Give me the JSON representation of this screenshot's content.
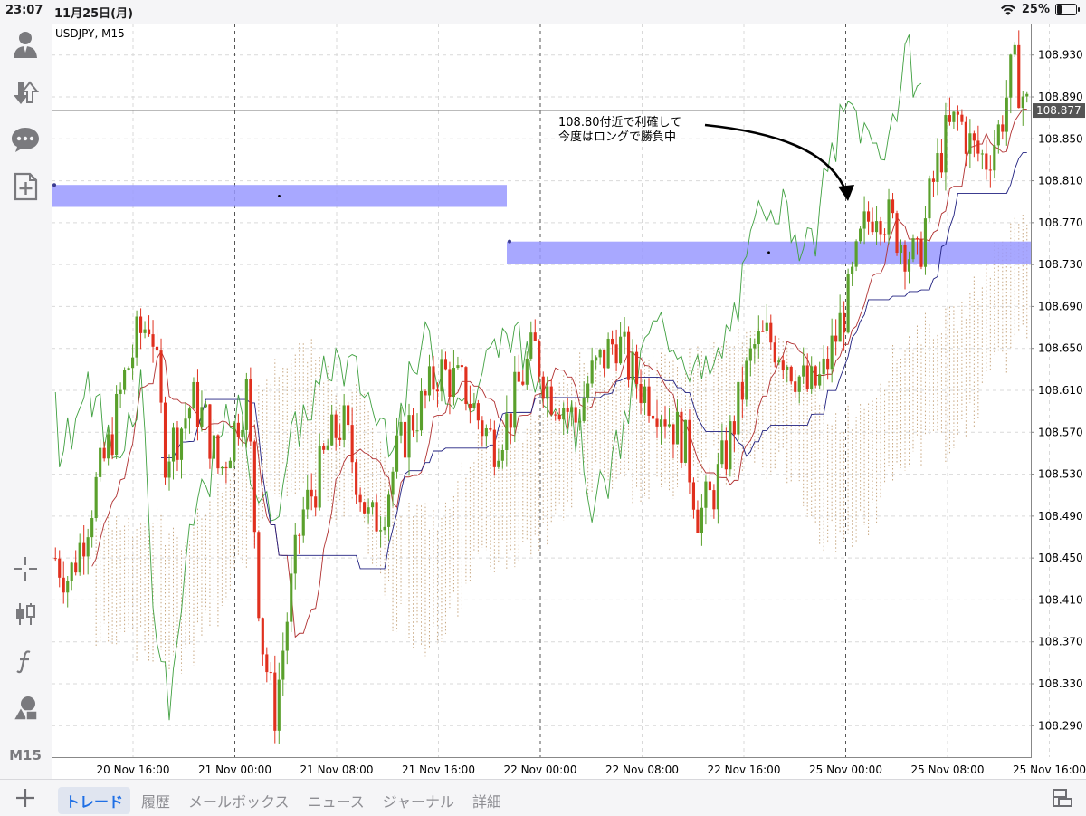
{
  "status_bar": {
    "time": "23:07",
    "date": "11月25日(月)",
    "battery": "25%",
    "battery_level": 0.25,
    "wifi_icon": "wifi-icon"
  },
  "toolbar": {
    "items": [
      {
        "name": "account-icon"
      },
      {
        "name": "trade-arrows-icon"
      },
      {
        "name": "chat-icon"
      },
      {
        "name": "new-order-icon"
      }
    ],
    "bottom_items": [
      {
        "name": "crosshair-icon"
      },
      {
        "name": "chart-type-icon"
      },
      {
        "name": "indicators-icon"
      },
      {
        "name": "objects-icon"
      }
    ],
    "timeframe": "M15"
  },
  "chart": {
    "symbol": "USDJPY, M15",
    "current_price": "108.877",
    "annotation_lines": [
      "108.80付近で利確して",
      "今度はロングで勝負中"
    ]
  },
  "chart_data": {
    "type": "candlestick",
    "symbol": "USDJPY",
    "timeframe": "M15",
    "y_ticks": [
      "108.930",
      "108.890",
      "108.850",
      "108.810",
      "108.770",
      "108.730",
      "108.690",
      "108.650",
      "108.610",
      "108.570",
      "108.530",
      "108.490",
      "108.450",
      "108.410",
      "108.370",
      "108.330",
      "108.290"
    ],
    "ylim": [
      108.26,
      108.96
    ],
    "x_ticks": [
      "20 Nov 16:00",
      "21 Nov 00:00",
      "21 Nov 08:00",
      "21 Nov 16:00",
      "22 Nov 00:00",
      "22 Nov 08:00",
      "22 Nov 16:00",
      "25 Nov 00:00",
      "25 Nov 08:00",
      "25 Nov 16:00"
    ],
    "current_price": 108.877,
    "bull_color": "#5aa02c",
    "bear_color": "#e0301e",
    "zones": [
      {
        "x_from": "20 Nov 09:00",
        "x_to": "21 Nov 23:30",
        "y_low": 108.785,
        "y_high": 108.806,
        "color": "#9999ff"
      },
      {
        "x_from": "21 Nov 23:30",
        "x_to": "25 Nov 16:00",
        "y_low": 108.731,
        "y_high": 108.752,
        "color": "#9999ff"
      }
    ],
    "series": [
      {
        "name": "close",
        "values": [
          108.45,
          108.43,
          108.47,
          108.52,
          108.56,
          108.62,
          108.66,
          108.68,
          108.55,
          108.57,
          108.6,
          108.58,
          108.53,
          108.57,
          108.61,
          108.38,
          108.3,
          108.4,
          108.49,
          108.52,
          108.56,
          108.58,
          108.53,
          108.48,
          108.5,
          108.55,
          108.58,
          108.6,
          108.63,
          108.62,
          108.61,
          108.58,
          108.56,
          108.58,
          108.62,
          108.65,
          108.61,
          108.6,
          108.58,
          108.62,
          108.64,
          108.66,
          108.63,
          108.61,
          108.6,
          108.58,
          108.56,
          108.49,
          108.51,
          108.55,
          108.6,
          108.65,
          108.66,
          108.65,
          108.63,
          108.61,
          108.62,
          108.66,
          108.7,
          108.76,
          108.79,
          108.77,
          108.75,
          108.73,
          108.8,
          108.85,
          108.87,
          108.84,
          108.83,
          108.86,
          108.92,
          108.88
        ]
      }
    ]
  },
  "bottom_tabs": [
    {
      "label": "トレード",
      "active": true
    },
    {
      "label": "履歴",
      "active": false
    },
    {
      "label": "メールボックス",
      "active": false
    },
    {
      "label": "ニュース",
      "active": false
    },
    {
      "label": "ジャーナル",
      "active": false
    },
    {
      "label": "詳細",
      "active": false
    }
  ],
  "colors": {
    "accent": "#1f6fe5",
    "bull": "#5aa02c",
    "bear": "#e0301e",
    "zone": "#9999ff",
    "kumo": "#c8a882"
  }
}
